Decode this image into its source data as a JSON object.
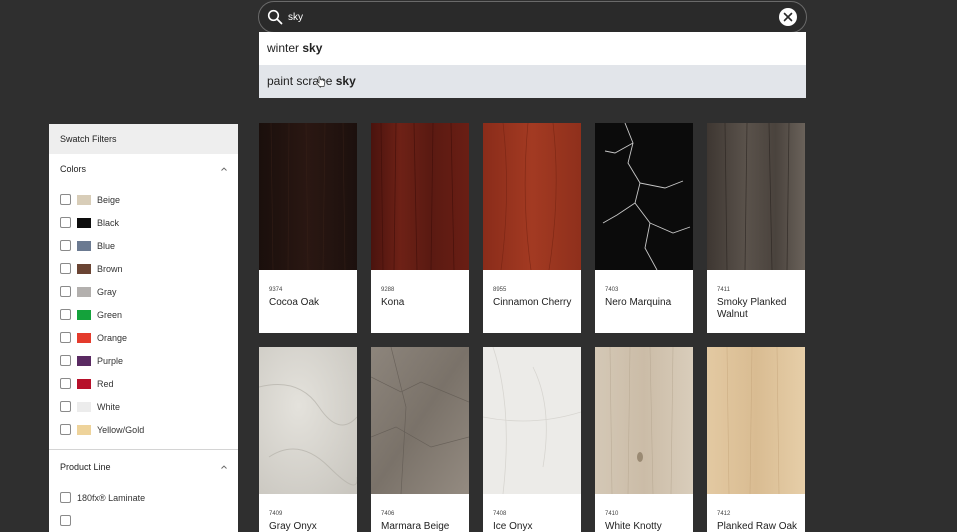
{
  "search": {
    "value": "sky",
    "suggestions": [
      {
        "prefix": "winter ",
        "match": "sky"
      },
      {
        "prefix": "paint scrape ",
        "match": "sky"
      }
    ]
  },
  "sidebar": {
    "title": "Swatch Filters",
    "colors": {
      "title": "Colors",
      "items": [
        {
          "label": "Beige",
          "color": "#d8cdb8"
        },
        {
          "label": "Black",
          "color": "#0d0d0d"
        },
        {
          "label": "Blue",
          "color": "#6b7a91"
        },
        {
          "label": "Brown",
          "color": "#6a4433"
        },
        {
          "label": "Gray",
          "color": "#b3b0ae"
        },
        {
          "label": "Green",
          "color": "#14a23b"
        },
        {
          "label": "Orange",
          "color": "#e43b2c"
        },
        {
          "label": "Purple",
          "color": "#5a2a62"
        },
        {
          "label": "Red",
          "color": "#b7102a"
        },
        {
          "label": "White",
          "color": "#ececec"
        },
        {
          "label": "Yellow/Gold",
          "color": "#eed39b"
        }
      ]
    },
    "product_line": {
      "title": "Product Line",
      "items": [
        {
          "label": "180fx® Laminate"
        }
      ]
    }
  },
  "swatches": [
    {
      "code": "9374",
      "name": "Cocoa Oak"
    },
    {
      "code": "9288",
      "name": "Kona"
    },
    {
      "code": "8955",
      "name": "Cinnamon Cherry"
    },
    {
      "code": "7403",
      "name": "Nero Marquina"
    },
    {
      "code": "7411",
      "name": "Smoky Planked Walnut"
    },
    {
      "code": "7409",
      "name": "Gray Onyx"
    },
    {
      "code": "7406",
      "name": "Marmara Beige"
    },
    {
      "code": "7408",
      "name": "Ice Onyx"
    },
    {
      "code": "7410",
      "name": "White Knotty"
    },
    {
      "code": "7412",
      "name": "Planked Raw Oak"
    }
  ],
  "theme": {
    "page_bg": "#2f2f2f",
    "card_bg": "#ffffff",
    "suggestion_hover": "#e2e5ea"
  }
}
